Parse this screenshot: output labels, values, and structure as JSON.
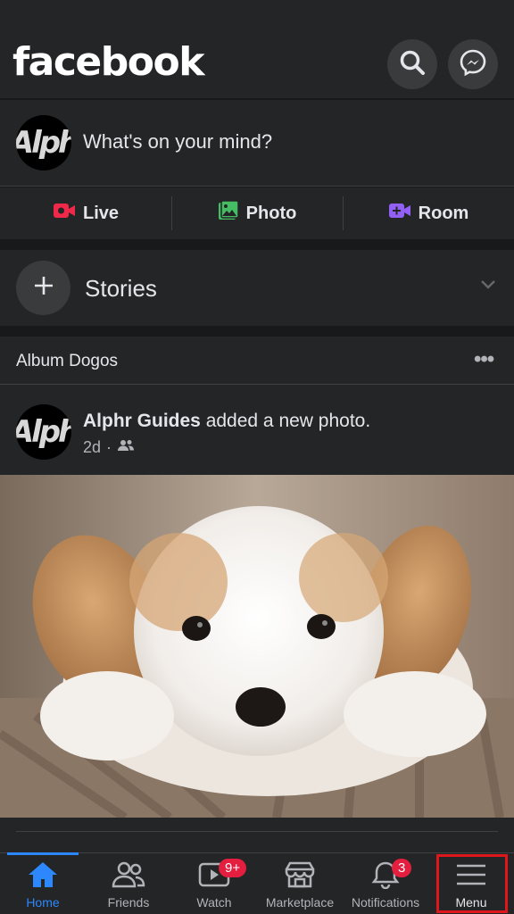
{
  "header": {
    "logo": "facebook",
    "search_icon": "search-icon",
    "messenger_icon": "messenger-icon"
  },
  "composer": {
    "avatar_text": "Alph",
    "prompt": "What's on your mind?"
  },
  "actions": [
    {
      "label": "Live",
      "icon": "video-camera-icon",
      "color": "#f02849"
    },
    {
      "label": "Photo",
      "icon": "photo-icon",
      "color": "#45bd62"
    },
    {
      "label": "Room",
      "icon": "room-video-icon",
      "color": "#9360f7"
    }
  ],
  "stories": {
    "label": "Stories"
  },
  "post": {
    "album_title": "Album Dogos",
    "more": "•••",
    "author": "Alphr Guides",
    "action_text": " added a new photo.",
    "time": "2d",
    "separator": "·",
    "avatar_text": "Alph",
    "audience_icon": "friends-audience-icon",
    "photo_icon": "puppy-photo"
  },
  "tabbar": {
    "tabs": [
      {
        "label": "Home",
        "icon": "home-icon",
        "active": true
      },
      {
        "label": "Friends",
        "icon": "friends-icon"
      },
      {
        "label": "Watch",
        "icon": "watch-icon",
        "badge": "9+"
      },
      {
        "label": "Marketplace",
        "icon": "marketplace-icon"
      },
      {
        "label": "Notifications",
        "icon": "bell-icon",
        "badge": "3"
      },
      {
        "label": "Menu",
        "icon": "hamburger-menu-icon"
      }
    ]
  },
  "colors": {
    "accent": "#2d88ff",
    "badge": "#e41e3f",
    "highlight": "#e0161d"
  }
}
